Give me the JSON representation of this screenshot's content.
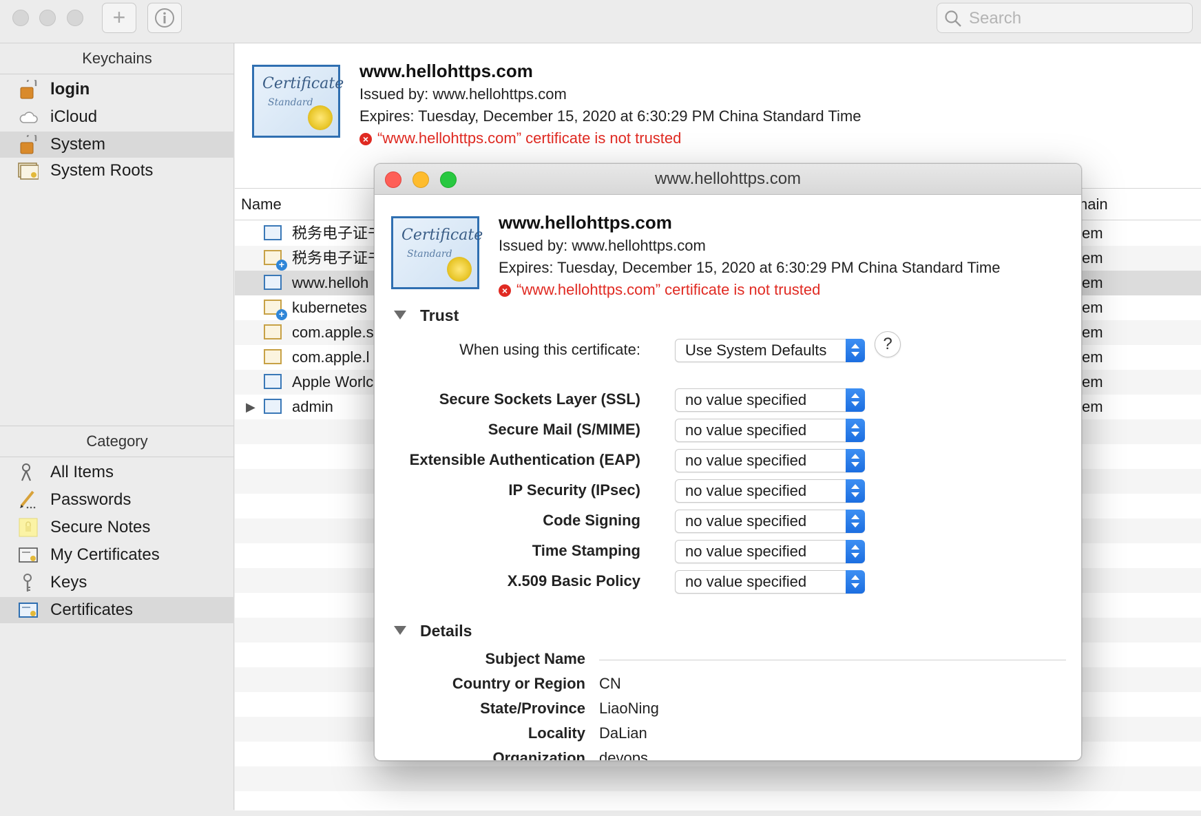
{
  "toolbar": {
    "search_placeholder": "Search",
    "add_icon": "plus-icon",
    "info_icon": "info-icon"
  },
  "sidebar": {
    "keychains_header": "Keychains",
    "keychains": [
      {
        "label": "login",
        "icon": "lock-open-icon",
        "bold": true
      },
      {
        "label": "iCloud",
        "icon": "cloud-icon"
      },
      {
        "label": "System",
        "icon": "lock-open-icon",
        "selected": true
      },
      {
        "label": "System Roots",
        "icon": "certificate-icon"
      }
    ],
    "category_header": "Category",
    "categories": [
      {
        "label": "All Items",
        "icon": "keys-icon"
      },
      {
        "label": "Passwords",
        "icon": "pencil-icon"
      },
      {
        "label": "Secure Notes",
        "icon": "note-icon"
      },
      {
        "label": "My Certificates",
        "icon": "certificate-icon"
      },
      {
        "label": "Keys",
        "icon": "key-icon"
      },
      {
        "label": "Certificates",
        "icon": "certificate-icon",
        "selected": true
      }
    ]
  },
  "cert_header": {
    "title": "www.hellohttps.com",
    "issued_by": "Issued by: www.hellohttps.com",
    "expires": "Expires: Tuesday, December 15, 2020 at 6:30:29 PM China Standard Time",
    "error": "“www.hellohttps.com” certificate is not trusted",
    "image_text_1": "Certificate",
    "image_text_2": "Standard"
  },
  "list": {
    "col_name": "Name",
    "col_keychain": "hain",
    "rows": [
      {
        "name": "税务电子证书",
        "keychain": "em",
        "icon": "cert-blue"
      },
      {
        "name": "税务电子证书",
        "keychain": "em",
        "icon": "cert-plus"
      },
      {
        "name": "www.helloh",
        "keychain": "em",
        "icon": "cert-blue",
        "selected": true
      },
      {
        "name": "kubernetes",
        "keychain": "em",
        "icon": "cert-plus"
      },
      {
        "name": "com.apple.s",
        "keychain": "em",
        "icon": "cert-gold"
      },
      {
        "name": "com.apple.l",
        "keychain": "em",
        "icon": "cert-gold"
      },
      {
        "name": "Apple Worlc",
        "keychain": "em",
        "icon": "cert-blue"
      },
      {
        "name": "admin",
        "keychain": "em",
        "icon": "cert-blue",
        "disclosure": true
      }
    ]
  },
  "dialog": {
    "title": "www.hellohttps.com",
    "cert_title": "www.hellohttps.com",
    "issued_by": "Issued by: www.hellohttps.com",
    "expires": "Expires: Tuesday, December 15, 2020 at 6:30:29 PM China Standard Time",
    "error": "“www.hellohttps.com” certificate is not trusted",
    "trust": {
      "section_label": "Trust",
      "when_using_label": "When using this certificate:",
      "when_using_value": "Use System Defaults",
      "help": "?",
      "policies": [
        {
          "label": "Secure Sockets Layer (SSL)",
          "value": "no value specified"
        },
        {
          "label": "Secure Mail (S/MIME)",
          "value": "no value specified"
        },
        {
          "label": "Extensible Authentication (EAP)",
          "value": "no value specified"
        },
        {
          "label": "IP Security (IPsec)",
          "value": "no value specified"
        },
        {
          "label": "Code Signing",
          "value": "no value specified"
        },
        {
          "label": "Time Stamping",
          "value": "no value specified"
        },
        {
          "label": "X.509 Basic Policy",
          "value": "no value specified"
        }
      ]
    },
    "details": {
      "section_label": "Details",
      "subject_name_label": "Subject Name",
      "fields": [
        {
          "label": "Country or Region",
          "value": "CN"
        },
        {
          "label": "State/Province",
          "value": "LiaoNing"
        },
        {
          "label": "Locality",
          "value": "DaLian"
        },
        {
          "label": "Organization",
          "value": "devops"
        }
      ]
    }
  }
}
